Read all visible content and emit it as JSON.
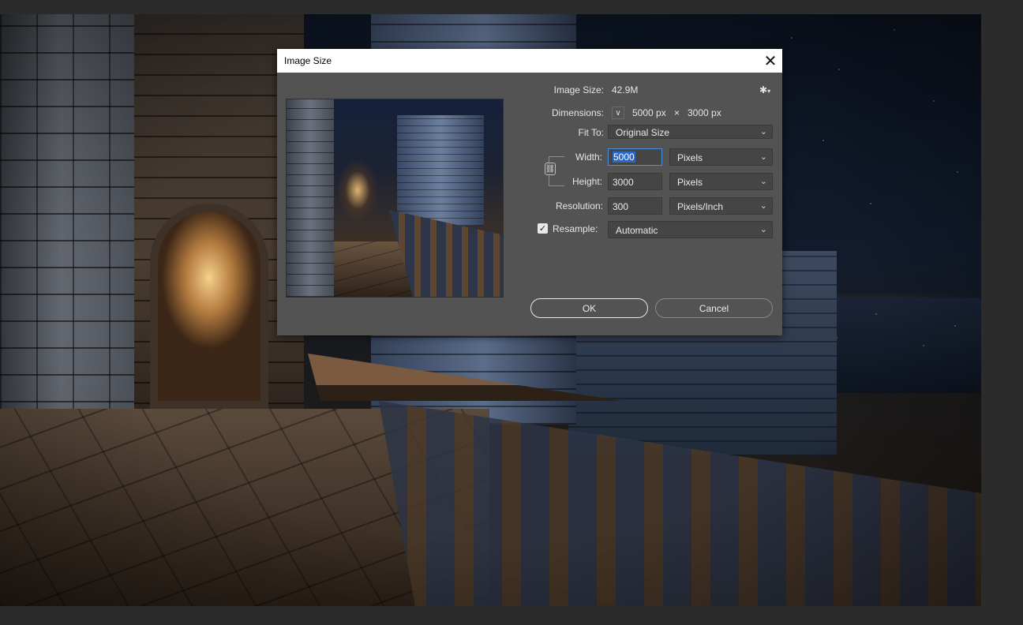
{
  "dialog": {
    "title": "Image Size",
    "image_size_label": "Image Size:",
    "image_size_value": "42.9M",
    "dimensions_label": "Dimensions:",
    "dimensions_width": "5000 px",
    "dimensions_sep": "×",
    "dimensions_height": "3000 px",
    "fit_to_label": "Fit To:",
    "fit_to_value": "Original Size",
    "width_label": "Width:",
    "width_value": "5000",
    "width_unit": "Pixels",
    "height_label": "Height:",
    "height_value": "3000",
    "height_unit": "Pixels",
    "resolution_label": "Resolution:",
    "resolution_value": "300",
    "resolution_unit": "Pixels/Inch",
    "resample_label": "Resample:",
    "resample_checked": true,
    "resample_value": "Automatic",
    "ok_label": "OK",
    "cancel_label": "Cancel"
  },
  "icons": {
    "close": "close-icon",
    "gear": "gear-icon",
    "chevron": "chevron-down-icon",
    "link": "link-chain-icon",
    "check": "checkmark-icon"
  },
  "colors": {
    "dialog_bg": "#535353",
    "field_bg": "#454545",
    "focus_blue": "#2a68c7",
    "workspace_bg": "#2b2b2b"
  }
}
